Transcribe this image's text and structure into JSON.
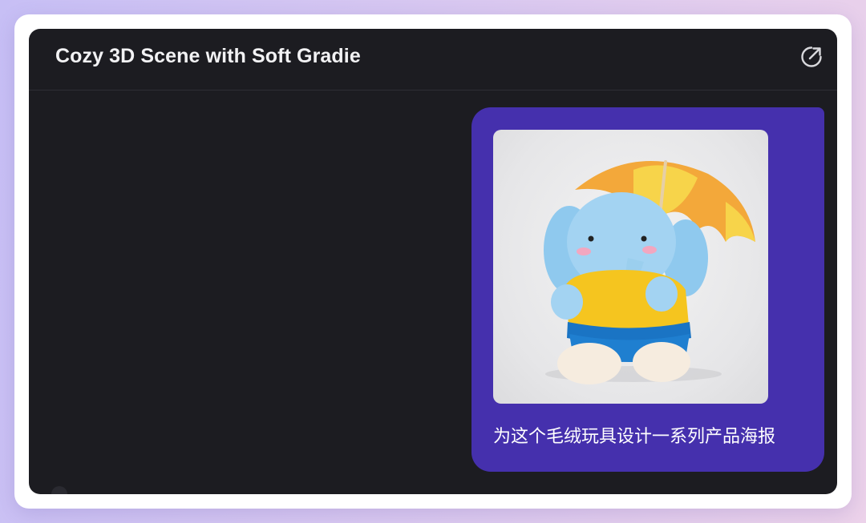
{
  "window": {
    "title": "Cozy 3D Scene with Soft Gradie",
    "open_icon": "external-link-icon"
  },
  "message": {
    "image_subject": "knitted blue elephant plush holding a yellow-orange umbrella",
    "text": "为这个毛绒玩具设计一系列产品海报"
  },
  "colors": {
    "background_gradient": [
      "#c7bff5",
      "#ecd2ea"
    ],
    "window_bg": "#1c1c21",
    "bubble_bg": "#4530ad",
    "text": "#f2f2f4"
  }
}
